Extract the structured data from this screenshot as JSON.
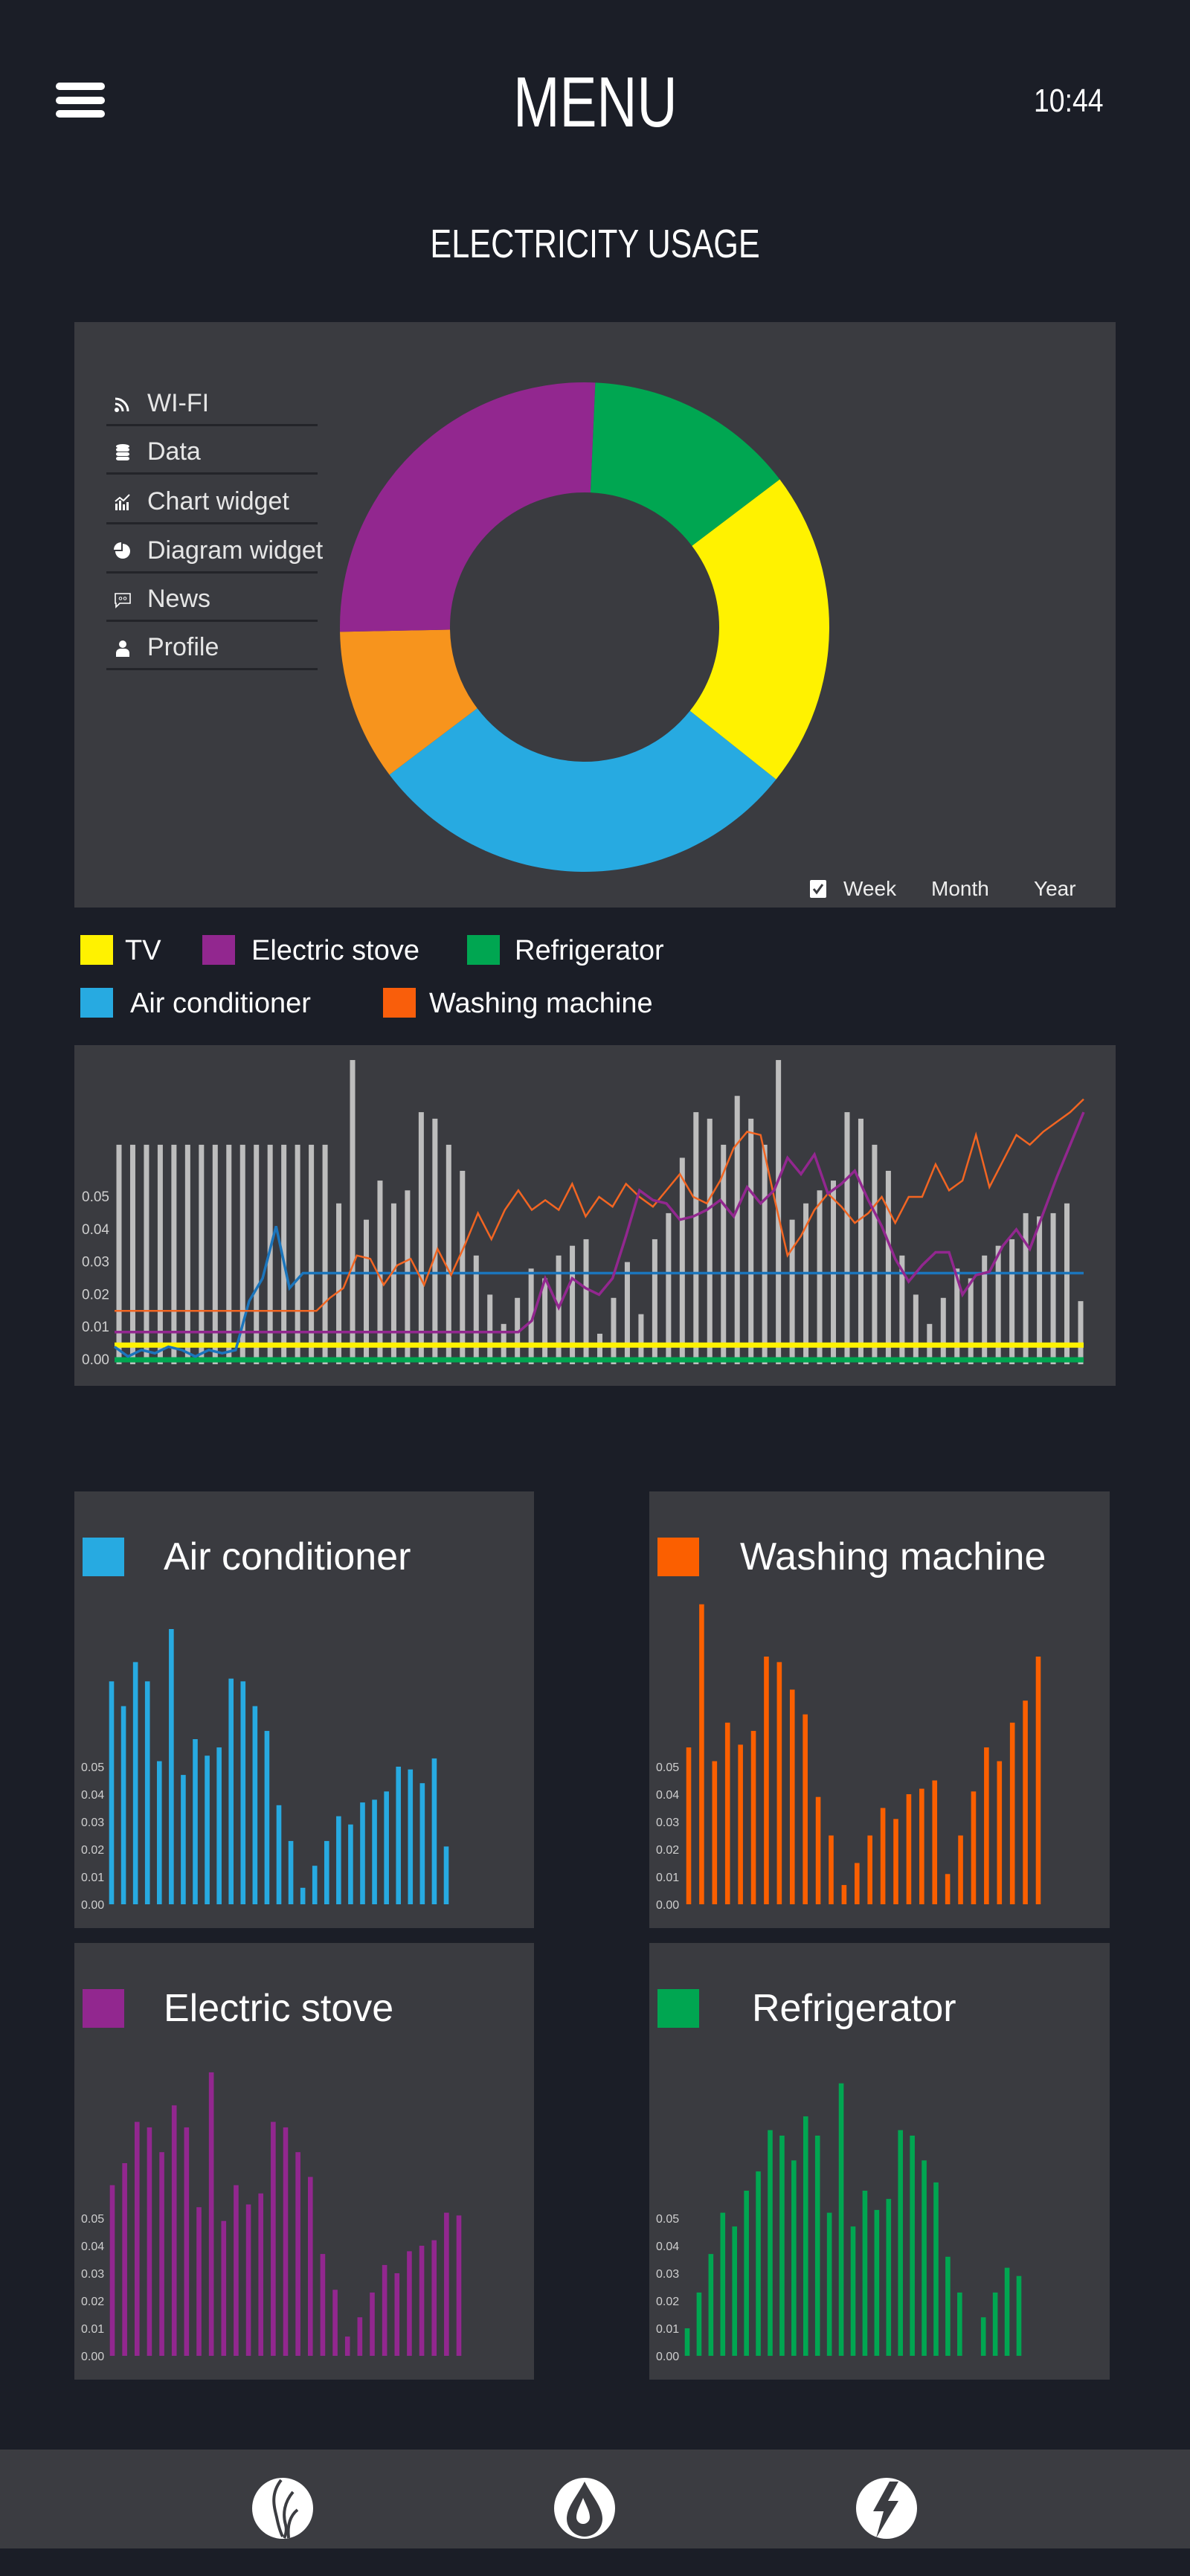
{
  "header": {
    "title": "MENU",
    "time": "10:44",
    "menu_icon": "hamburger-icon"
  },
  "section_title": "ELECTRICITY USAGE",
  "side_menu": [
    {
      "label": "WI-FI",
      "icon": "wifi-icon"
    },
    {
      "label": "Data",
      "icon": "database-icon"
    },
    {
      "label": "Chart widget",
      "icon": "chart-icon"
    },
    {
      "label": "Diagram widget",
      "icon": "pie-chart-icon"
    },
    {
      "label": "News",
      "icon": "chat-icon"
    },
    {
      "label": "Profile",
      "icon": "user-icon"
    }
  ],
  "period": {
    "options": [
      "Week",
      "Month",
      "Year"
    ],
    "selected": "Week"
  },
  "legend": [
    {
      "label": "TV",
      "color": "#fff200"
    },
    {
      "label": "Electric stove",
      "color": "#92278f"
    },
    {
      "label": "Refrigerator",
      "color": "#00a651"
    },
    {
      "label": "Air conditioner",
      "color": "#27aae1"
    },
    {
      "label": "Washing machine",
      "color": "#f95e0b"
    }
  ],
  "chart_data": [
    {
      "type": "pie",
      "donut": true,
      "slices": [
        {
          "color": "#00a651",
          "value": 14
        },
        {
          "color": "#fff200",
          "value": 21
        },
        {
          "color": "#27aae1",
          "value": 29
        },
        {
          "color": "#f7941d",
          "value": 10
        },
        {
          "color": "#92278f",
          "value": 26
        }
      ]
    },
    {
      "type": "line",
      "yticks": [
        "0.00",
        "0.01",
        "0.02",
        "0.03",
        "0.04",
        "0.05"
      ],
      "grid": false,
      "background_bars": {
        "color": "#bdbdbd",
        "values": [
          0.066,
          0.066,
          0.066,
          0.066,
          0.066,
          0.066,
          0.066,
          0.066,
          0.066,
          0.066,
          0.066,
          0.066,
          0.066,
          0.066,
          0.066,
          0.066,
          0.048,
          0.092,
          0.043,
          0.055,
          0.048,
          0.052,
          0.076,
          0.074,
          0.066,
          0.058,
          0.032,
          0.02,
          0.011,
          0.019,
          0.028,
          0.025,
          0.032,
          0.035,
          0.037,
          0.008,
          0.019,
          0.03,
          0.014,
          0.037,
          0.045,
          0.062,
          0.076,
          0.074,
          0.066,
          0.081,
          0.074,
          0.066,
          0.092,
          0.043,
          0.048,
          0.052,
          0.055,
          0.076,
          0.074,
          0.066,
          0.058,
          0.032,
          0.02,
          0.011,
          0.019,
          0.028,
          0.025,
          0.032,
          0.035,
          0.037,
          0.045,
          0.044,
          0.045,
          0.048,
          0.018
        ]
      },
      "series": [
        {
          "name": "TV",
          "color": "#fff200",
          "values": [
            0.0045,
            0.0045
          ]
        },
        {
          "name": "Refrigerator",
          "color": "#00a651",
          "values": [
            0.0,
            0.0
          ]
        },
        {
          "name": "Air conditioner",
          "color": "#1b75bc",
          "values": [
            0.004,
            0.001,
            0.003,
            0.002,
            0.004,
            0.003,
            0.001,
            0.003,
            0.002,
            0.003,
            0.018,
            0.025,
            0.041,
            0.022,
            0.0266,
            0.0266,
            0.0266,
            0.0266,
            0.0266,
            0.0266,
            0.0266,
            0.0266,
            0.0266,
            0.0266,
            0.0266,
            0.0266,
            0.0266,
            0.0266,
            0.0266,
            0.0266,
            0.0266,
            0.0266,
            0.0266,
            0.0266,
            0.0266,
            0.0266,
            0.0266,
            0.0266,
            0.0266,
            0.0266,
            0.0266,
            0.0266,
            0.0266,
            0.0266,
            0.0266,
            0.0266,
            0.0266,
            0.0266,
            0.0266,
            0.0266,
            0.0266,
            0.0266,
            0.0266,
            0.0266,
            0.0266,
            0.0266,
            0.0266,
            0.0266,
            0.0266,
            0.0266,
            0.0266,
            0.0266,
            0.0266,
            0.0266,
            0.0266,
            0.0266,
            0.0266,
            0.0266,
            0.0266,
            0.0266,
            0.0266,
            0.0266,
            0.0266
          ]
        },
        {
          "name": "Washing machine",
          "color": "#f26522",
          "values": [
            0.015,
            0.015,
            0.015,
            0.015,
            0.015,
            0.015,
            0.015,
            0.015,
            0.015,
            0.015,
            0.015,
            0.015,
            0.015,
            0.015,
            0.015,
            0.015,
            0.019,
            0.022,
            0.032,
            0.031,
            0.023,
            0.029,
            0.031,
            0.023,
            0.034,
            0.026,
            0.035,
            0.045,
            0.037,
            0.046,
            0.052,
            0.046,
            0.049,
            0.046,
            0.054,
            0.044,
            0.05,
            0.047,
            0.054,
            0.05,
            0.047,
            0.052,
            0.057,
            0.05,
            0.048,
            0.055,
            0.065,
            0.07,
            0.069,
            0.05,
            0.032,
            0.038,
            0.046,
            0.051,
            0.047,
            0.042,
            0.045,
            0.05,
            0.042,
            0.05,
            0.05,
            0.06,
            0.052,
            0.055,
            0.069,
            0.053,
            0.061,
            0.069,
            0.066,
            0.07,
            0.073,
            0.076,
            0.08
          ]
        },
        {
          "name": "Electric stove",
          "color": "#92278f",
          "values": [
            0.0085,
            0.0085,
            0.0085,
            0.0085,
            0.0085,
            0.0085,
            0.0085,
            0.0085,
            0.0085,
            0.0085,
            0.0085,
            0.0085,
            0.0085,
            0.0085,
            0.0085,
            0.0085,
            0.0085,
            0.0085,
            0.0085,
            0.0085,
            0.0085,
            0.0085,
            0.0085,
            0.0085,
            0.0085,
            0.0085,
            0.0085,
            0.0085,
            0.0085,
            0.0085,
            0.0085,
            0.012,
            0.025,
            0.016,
            0.025,
            0.022,
            0.02,
            0.025,
            0.038,
            0.052,
            0.049,
            0.048,
            0.043,
            0.044,
            0.046,
            0.049,
            0.044,
            0.053,
            0.048,
            0.052,
            0.062,
            0.057,
            0.063,
            0.051,
            0.054,
            0.058,
            0.049,
            0.041,
            0.031,
            0.024,
            0.029,
            0.033,
            0.033,
            0.02,
            0.026,
            0.027,
            0.035,
            0.04,
            0.034,
            0.045,
            0.056,
            0.066,
            0.076
          ]
        }
      ]
    },
    {
      "type": "bar",
      "title": "Air conditioner",
      "color": "#27aae1",
      "yticks": [
        "0.00",
        "0.01",
        "0.02",
        "0.03",
        "0.04",
        "0.05"
      ],
      "values": [
        0.081,
        0.072,
        0.088,
        0.081,
        0.052,
        0.1,
        0.047,
        0.06,
        0.054,
        0.057,
        0.082,
        0.081,
        0.072,
        0.063,
        0.036,
        0.023,
        0.006,
        0.014,
        0.023,
        0.032,
        0.029,
        0.037,
        0.038,
        0.041,
        0.05,
        0.049,
        0.044,
        0.053,
        0.021
      ]
    },
    {
      "type": "bar",
      "title": "Washing machine",
      "color": "#fb5f00",
      "yticks": [
        "0.00",
        "0.01",
        "0.02",
        "0.03",
        "0.04",
        "0.05"
      ],
      "values": [
        0.057,
        0.109,
        0.052,
        0.066,
        0.058,
        0.063,
        0.09,
        0.088,
        0.078,
        0.069,
        0.039,
        0.025,
        0.007,
        0.015,
        0.025,
        0.035,
        0.031,
        0.04,
        0.042,
        0.045,
        0.011,
        0.025,
        0.041,
        0.057,
        0.052,
        0.066,
        0.074,
        0.09
      ]
    },
    {
      "type": "bar",
      "title": "Electric stove",
      "color": "#92278f",
      "yticks": [
        "0.00",
        "0.01",
        "0.02",
        "0.03",
        "0.04",
        "0.05"
      ],
      "values": [
        0.062,
        0.07,
        0.085,
        0.083,
        0.074,
        0.091,
        0.083,
        0.054,
        0.103,
        0.049,
        0.062,
        0.055,
        0.059,
        0.085,
        0.083,
        0.074,
        0.065,
        0.037,
        0.024,
        0.007,
        0.014,
        0.023,
        0.033,
        0.03,
        0.038,
        0.04,
        0.042,
        0.052,
        0.051
      ]
    },
    {
      "type": "bar",
      "title": "Refrigerator",
      "color": "#00a651",
      "yticks": [
        "0.00",
        "0.01",
        "0.02",
        "0.03",
        "0.04",
        "0.05"
      ],
      "values": [
        0.01,
        0.023,
        0.037,
        0.052,
        0.047,
        0.06,
        0.067,
        0.082,
        0.08,
        0.071,
        0.087,
        0.08,
        0.052,
        0.099,
        0.047,
        0.06,
        0.053,
        0.057,
        0.082,
        0.08,
        0.071,
        0.063,
        0.036,
        0.023,
        0.0,
        0.014,
        0.023,
        0.032,
        0.029
      ]
    }
  ],
  "bottom_nav": [
    {
      "icon": "gas-flame-icon"
    },
    {
      "icon": "water-drop-icon"
    },
    {
      "icon": "electricity-bolt-icon"
    }
  ]
}
